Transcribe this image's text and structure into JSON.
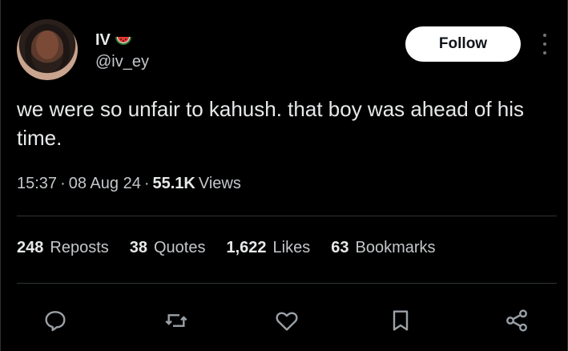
{
  "author": {
    "display_name": "IV",
    "handle": "@iv_ey",
    "emoji_icon": "watermelon-icon"
  },
  "follow_label": "Follow",
  "tweet": {
    "text": "we were so unfair to kahush. that boy was ahead of his time."
  },
  "meta": {
    "time": "15:37",
    "sep1": "·",
    "date": "08 Aug 24",
    "sep2": "·",
    "views_count": "55.1K",
    "views_label": "Views"
  },
  "stats": [
    {
      "num": "248",
      "label": "Reposts"
    },
    {
      "num": "38",
      "label": "Quotes"
    },
    {
      "num": "1,622",
      "label": "Likes"
    },
    {
      "num": "63",
      "label": "Bookmarks"
    }
  ],
  "actions": [
    "reply-icon",
    "repost-icon",
    "like-icon",
    "bookmark-icon",
    "share-icon"
  ],
  "colors": {
    "background": "#000000",
    "text": "#e7e9ea",
    "secondary_text": "#c4c7ca",
    "divider": "#2f3336",
    "follow_bg": "#ffffff"
  }
}
